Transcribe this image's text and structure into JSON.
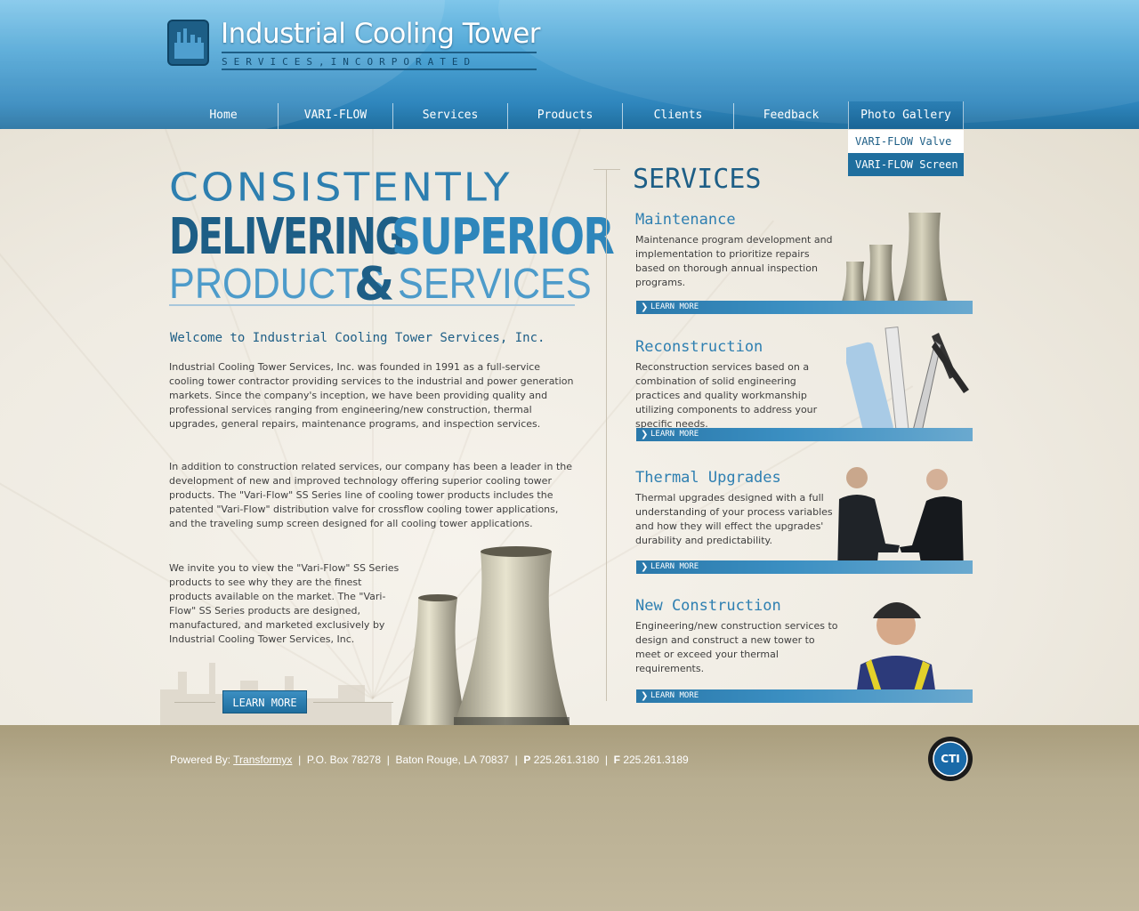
{
  "header": {
    "logo_name": "Industrial Cooling Tower",
    "logo_sub": "SERVICES,INCORPORATED"
  },
  "nav": {
    "items": [
      {
        "label": "Home"
      },
      {
        "label": "VARI-FLOW"
      },
      {
        "label": "Services"
      },
      {
        "label": "Products"
      },
      {
        "label": "Clients"
      },
      {
        "label": "Feedback"
      },
      {
        "label": "Photo Gallery"
      }
    ],
    "active": "Photo Gallery",
    "dropdown": [
      {
        "label": "VARI-FLOW Valve"
      },
      {
        "label": "VARI-FLOW Screen"
      }
    ]
  },
  "headline": {
    "line1": "CONSISTENTLY",
    "line2a": "DELIVERING",
    "line2b": "SUPERIOR",
    "line3a": "PRODUCTS",
    "line3amp": "&",
    "line3b": "SERVICES"
  },
  "welcome": {
    "title": "Welcome to Industrial Cooling Tower Services, Inc.",
    "p1": "Industrial Cooling Tower Services, Inc. was founded in 1991 as a full-service cooling tower contractor providing services to the industrial and power generation markets. Since the company's inception, we have been providing quality and professional services ranging from engineering/new construction, thermal upgrades, general repairs, maintenance programs, and inspection services.",
    "p2": "In addition to construction related services, our company has been a leader in the development of new and improved technology offering superior cooling tower products. The \"Vari-Flow\" SS Series line of cooling tower products includes the patented \"Vari-Flow\" distribution valve for crossflow cooling tower applications, and the traveling sump screen designed for all cooling tower applications.",
    "p3": "We invite you to view the \"Vari-Flow\" SS Series products to see why they are the finest products available on the market. The \"Vari-Flow\" SS Series products are designed, manufactured, and marketed exclusively by Industrial Cooling Tower Services, Inc.",
    "learn_more": "LEARN MORE"
  },
  "services": {
    "title": "SERVICES",
    "items": [
      {
        "title": "Maintenance",
        "desc": "Maintenance program development and implementation to prioritize repairs based on thorough annual inspection programs.",
        "link": "LEARN MORE"
      },
      {
        "title": "Reconstruction",
        "desc": "Reconstruction services based on a combination of solid engineering practices and quality workmanship utilizing components to address your specific needs.",
        "link": "LEARN MORE"
      },
      {
        "title": "Thermal Upgrades",
        "desc": "Thermal upgrades designed with a full understanding of your process variables and how they will effect the upgrades' durability and predictability.",
        "link": "LEARN MORE"
      },
      {
        "title": "New Construction",
        "desc": "Engineering/new construction services to design and construct a new tower to meet or exceed your thermal requirements.",
        "link": "LEARN MORE"
      }
    ]
  },
  "footer": {
    "powered_label": "Powered By:",
    "powered_link": "Transformyx",
    "address": "P.O. Box 78278",
    "city": "Baton Rouge, LA 70837",
    "phone_label": "P",
    "phone": "225.261.3180",
    "fax_label": "F",
    "fax": "225.261.3189",
    "badge_text": "CTI",
    "badge_ring": "COOLING TECHNOLOGY INSTITUTE"
  }
}
